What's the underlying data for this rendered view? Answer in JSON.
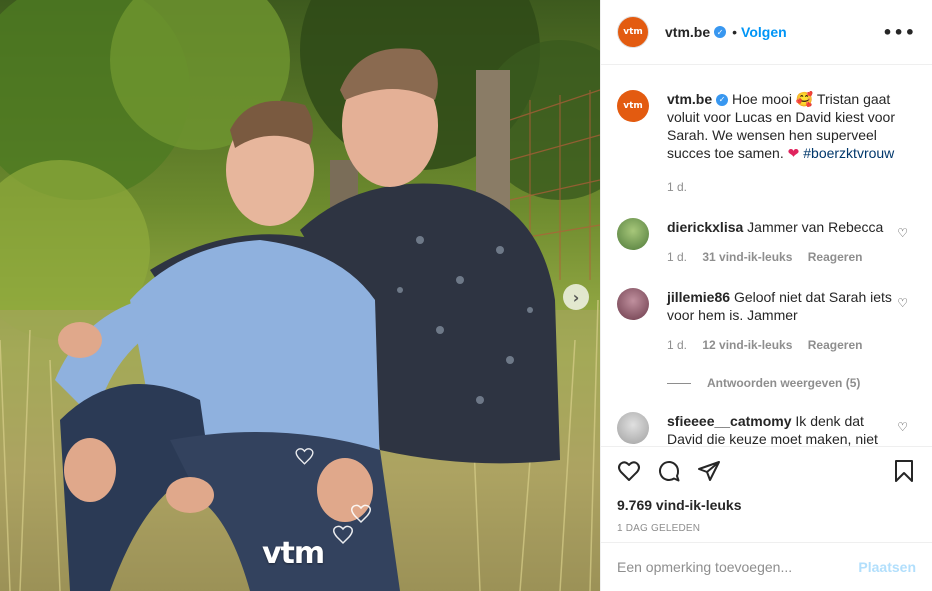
{
  "post": {
    "account": "vtm.be",
    "avatar_text": "vtm",
    "follow_label": "Volgen",
    "more_icon": "more-options-icon",
    "verified_icon": "verified-badge-icon"
  },
  "photo": {
    "watermark": "vtm",
    "next_icon": "chevron-right-icon"
  },
  "caption": {
    "username": "vtm.be",
    "text_1": "Hoe mooi",
    "emoji_1": "🥰",
    "text_2": "Tristan gaat voluit voor Lucas en David kiest voor Sarah. We wensen hen superveel succes toe samen.",
    "emoji_2": "❤",
    "hashtag": "#boerzktvrouw",
    "time": "1 d."
  },
  "comments": [
    {
      "username": "dierickxlisa",
      "text": "Jammer van Rebecca",
      "time": "1 d.",
      "likes": "31 vind-ik-leuks",
      "reply": "Reageren",
      "avatar_color": "#4f7a3a"
    },
    {
      "username": "jillemie86",
      "text": "Geloof niet dat Sarah iets voor hem is. Jammer",
      "time": "1 d.",
      "likes": "12 vind-ik-leuks",
      "reply": "Reageren",
      "view_replies": "Antwoorden weergeven (5)",
      "avatar_color": "#6b3a4a"
    },
    {
      "username": "sfieeee__catmomy",
      "text": "Ik denk dat David die keuze moet maken, niet",
      "avatar_color": "#a0a0a0"
    }
  ],
  "actions": {
    "like_icon": "heart-icon",
    "comment_icon": "comment-icon",
    "share_icon": "share-icon",
    "save_icon": "bookmark-icon",
    "likes_count": "9.769 vind-ik-leuks",
    "posted": "1 DAG GELEDEN"
  },
  "add_comment": {
    "placeholder": "Een opmerking toevoegen...",
    "post_label": "Plaatsen"
  },
  "colors": {
    "accent": "#0095f6",
    "brand": "#e35b10",
    "muted": "#8e8e8e"
  }
}
